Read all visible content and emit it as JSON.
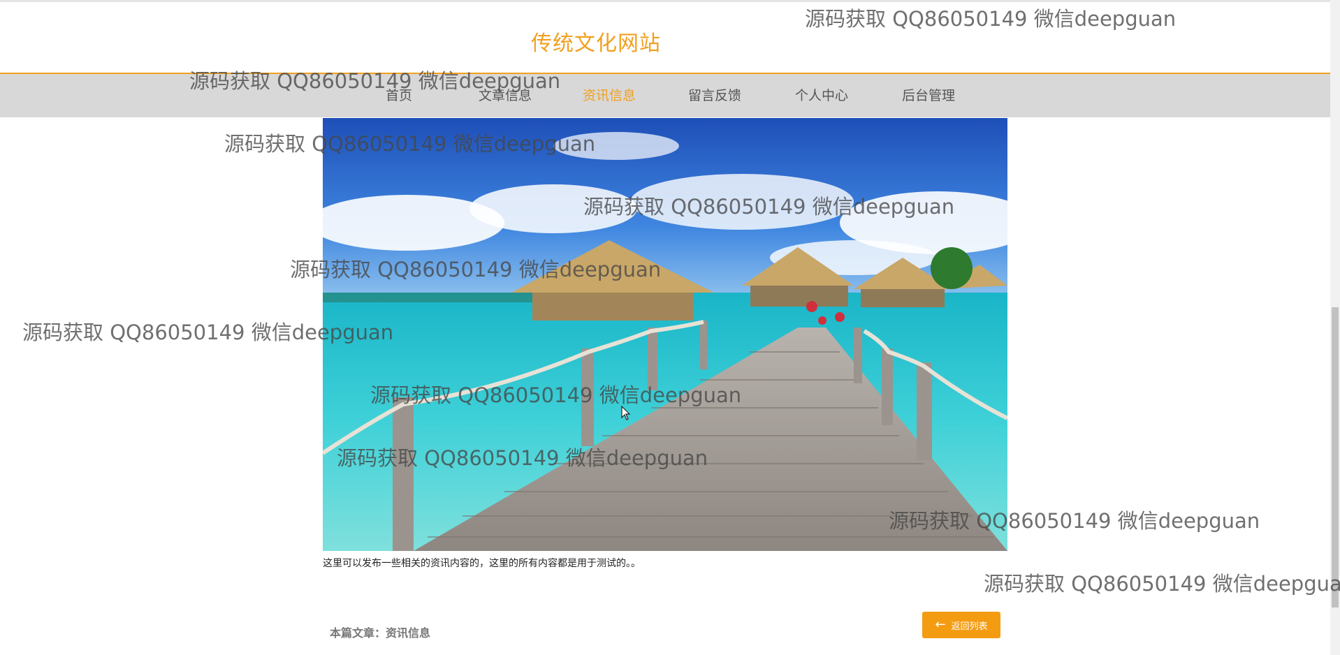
{
  "header": {
    "site_title": "传统文化网站"
  },
  "nav": {
    "items": [
      {
        "label": "首页",
        "active": false
      },
      {
        "label": "文章信息",
        "active": false
      },
      {
        "label": "资讯信息",
        "active": true
      },
      {
        "label": "留言反馈",
        "active": false
      },
      {
        "label": "个人中心",
        "active": false
      },
      {
        "label": "后台管理",
        "active": false
      }
    ]
  },
  "article": {
    "content": "这里可以发布一些相关的资讯内容的，这里的所有内容都是用于测试的。。",
    "footer": "本篇文章：资讯信息",
    "back_label": "返回列表"
  },
  "watermark": {
    "text": "源码获取 QQ86050149 微信deepguan",
    "partial_text": "源码获取 QQ86050149 微信deepgua"
  },
  "colors": {
    "accent": "#f0a01f",
    "nav_bg": "#d8d8d8",
    "button": "#f39c12"
  }
}
